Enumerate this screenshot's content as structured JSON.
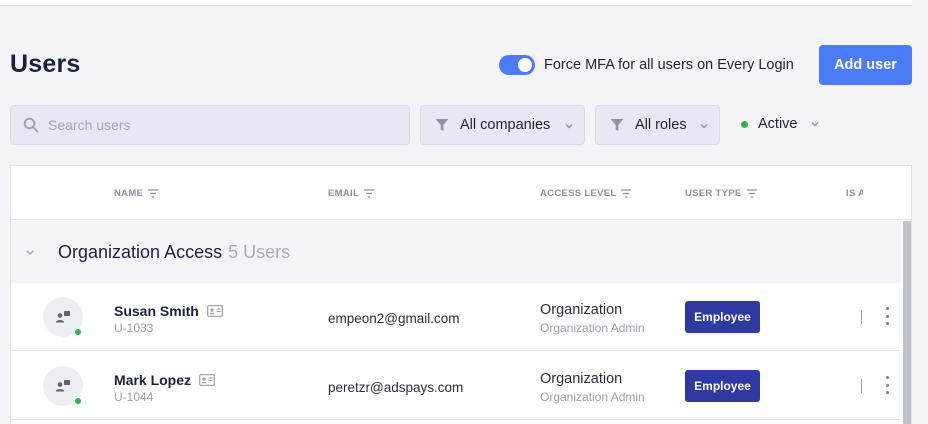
{
  "page": {
    "title": "Users"
  },
  "mfa": {
    "label": "Force MFA for all users on Every Login",
    "enabled": true
  },
  "actions": {
    "add_user": "Add user"
  },
  "search": {
    "placeholder": "Search users"
  },
  "filters": {
    "companies": "All companies",
    "roles": "All roles",
    "status": "Active"
  },
  "table": {
    "columns": {
      "name": "NAME",
      "email": "EMAIL",
      "access_level": "ACCESS LEVEL",
      "user_type": "USER TYPE",
      "is": "IS A"
    },
    "group": {
      "title": "Organization Access",
      "count": "5 Users"
    },
    "rows": [
      {
        "name": "Susan Smith",
        "id": "U-1033",
        "email": "empeon2@gmail.com",
        "access": "Organization",
        "access_sub": "Organization Admin",
        "type": "Employee"
      },
      {
        "name": "Mark Lopez",
        "id": "U-1044",
        "email": "peretzr@adspays.com",
        "access": "Organization",
        "access_sub": "Organization Admin",
        "type": "Employee"
      }
    ]
  },
  "colors": {
    "accent": "#4b7bf5",
    "badge": "#2e3a9f",
    "online": "#2fb350"
  },
  "icons": [
    "search-icon",
    "funnel-icon",
    "chevron-down-icon",
    "sort-icon",
    "user-avatar-icon",
    "id-card-icon",
    "kebab-menu-icon"
  ]
}
